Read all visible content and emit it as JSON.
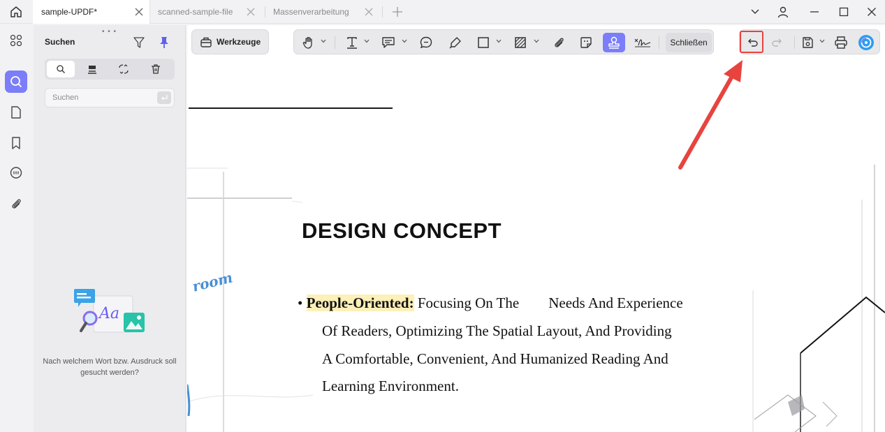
{
  "tabs": [
    {
      "label": "sample-UPDF*",
      "active": true
    },
    {
      "label": "scanned-sample-file",
      "active": false
    },
    {
      "label": "Massenverarbeitung",
      "active": false
    }
  ],
  "search_panel": {
    "title": "Suchen",
    "search_placeholder": "Suchen",
    "empty_message": "Nach welchem Wort bzw. Ausdruck soll gesucht werden?"
  },
  "toolbar": {
    "tools_label": "Werkzeuge",
    "close_label": "Schließen"
  },
  "document": {
    "heading": "DESIGN CONCEPT",
    "bullet_term": "People-Oriented:",
    "bullet_lines": [
      "Focusing On The        Needs And Experience",
      "Of Readers, Optimizing The Spatial Layout, And Providing",
      "A Comfortable, Convenient, And Humanized Reading And",
      "Learning Environment."
    ],
    "fragment_text": "room"
  },
  "colors": {
    "accent": "#7b7ef8",
    "highlight": "#fdf0b8",
    "annotation_red": "#e8433e",
    "fragment_blue": "#4a8fd6"
  }
}
